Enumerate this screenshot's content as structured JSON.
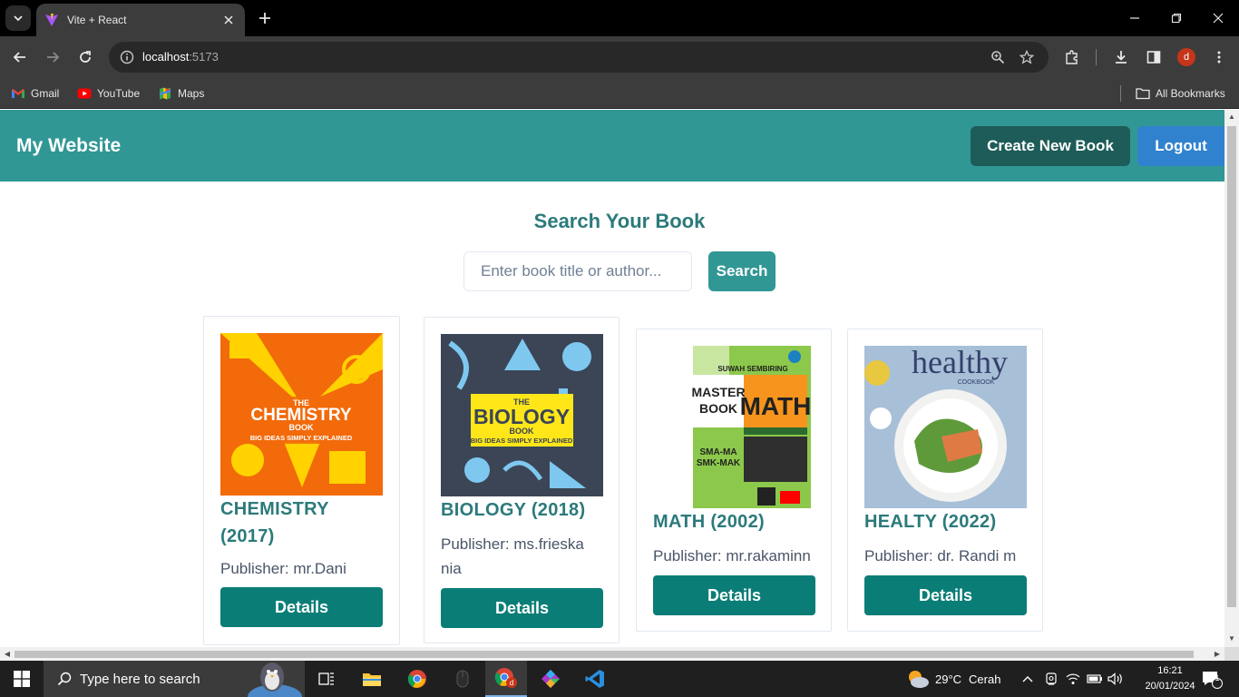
{
  "browser": {
    "tab_title": "Vite + React",
    "url_host": "localhost",
    "url_port": ":5173",
    "profile_initial": "d",
    "bookmarks": [
      {
        "label": "Gmail",
        "icon": "gmail-icon"
      },
      {
        "label": "YouTube",
        "icon": "youtube-icon"
      },
      {
        "label": "Maps",
        "icon": "maps-icon"
      }
    ],
    "all_bookmarks_label": "All Bookmarks"
  },
  "navbar": {
    "brand": "My Website",
    "create_label": "Create New Book",
    "logout_label": "Logout",
    "bg_color": "#319795"
  },
  "search": {
    "heading": "Search Your Book",
    "placeholder": "Enter book title or author...",
    "button_label": "Search"
  },
  "books": [
    {
      "title": "CHEMISTRY (2017)",
      "publisher": "Publisher: mr.Dani",
      "cover_text": [
        "THE",
        "CHEMISTRY",
        "BOOK",
        "BIG IDEAS SIMPLY EXPLAINED"
      ],
      "details_label": "Details"
    },
    {
      "title": "BIOLOGY (2018)",
      "publisher": "Publisher: ms.frieskania",
      "cover_text": [
        "THE",
        "BIOLOGY",
        "BOOK",
        "BIG IDEAS SIMPLY EXPLAINED"
      ],
      "details_label": "Details"
    },
    {
      "title": "MATH (2002)",
      "publisher": "Publisher: mr.rakaminn",
      "cover_text": [
        "SUWAH SEMBIRING",
        "MASTER",
        "BOOK",
        "MATH",
        "SMA-MA",
        "SMK-MAK"
      ],
      "details_label": "Details"
    },
    {
      "title": "HEALTY (2022)",
      "publisher": "Publisher: dr. Randi m",
      "cover_text": [
        "healthy",
        "COOKBOOK"
      ],
      "details_label": "Details"
    }
  ],
  "taskbar": {
    "search_placeholder": "Type here to search",
    "weather_temp": "29°C",
    "weather_desc": "Cerah",
    "time": "16:21",
    "date": "20/01/2024",
    "notification_count": "1"
  }
}
